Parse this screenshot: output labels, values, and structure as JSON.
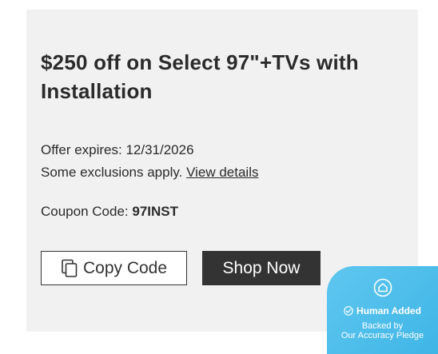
{
  "offer": {
    "title": "$250 off on Select 97\"+TVs with Installation",
    "expires": "Offer expires: 12/31/2026",
    "exclusions_text": "Some exclusions apply.",
    "details_link": "View details",
    "coupon_label": "Coupon Code:",
    "coupon_code": "97INST"
  },
  "buttons": {
    "copy_code": "Copy Code",
    "shop_now": "Shop Now"
  },
  "badge": {
    "title": "Human Added",
    "line1": "Backed by",
    "line2": "Our Accuracy Pledge",
    "color": "#4bbde9"
  },
  "icons": {
    "copy": "copy-icon",
    "shield": "shield-icon",
    "check": "check-circle-icon"
  },
  "colors": {
    "card_bg": "#f1f1f1",
    "text": "#2b2b2b",
    "button_dark": "#333333"
  }
}
